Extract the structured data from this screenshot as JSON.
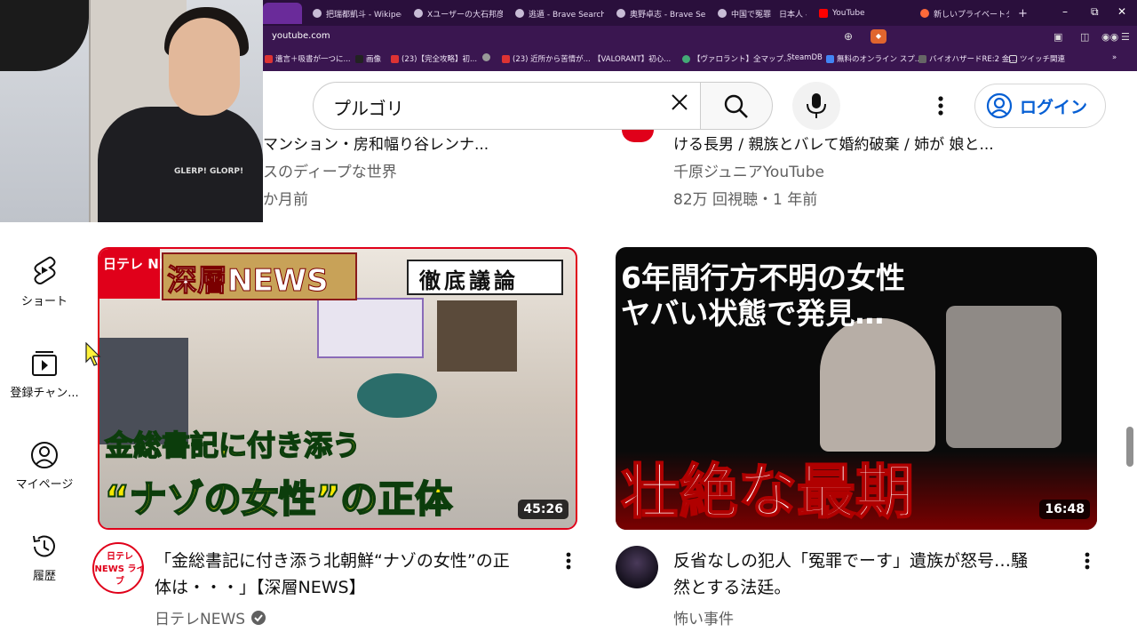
{
  "browser": {
    "tabs": [
      {
        "label": "把瑞都凱斗 - Wikipedia"
      },
      {
        "label": "Xユーザーの大石邦彦【C"
      },
      {
        "label": "逃遁 - Brave Search"
      },
      {
        "label": "奥野卓志 - Brave Search"
      },
      {
        "label": "中国で冤罪　日本人 -"
      },
      {
        "label": "YouTube"
      },
      {
        "label": "新しいプライベートタブ"
      }
    ],
    "new_tab": "+",
    "url": "youtube.com",
    "bookmarks": [
      {
        "label": "遺言＋吸書が一つに..."
      },
      {
        "label": "画像"
      },
      {
        "label": "(23)【完全攻略】初..."
      },
      {
        "label": "(23) 近所から苦情が..."
      },
      {
        "label": "【VALORANT】初心..."
      },
      {
        "label": "【ヴァロラント】全マップ..."
      },
      {
        "label": "SteamDB"
      },
      {
        "label": "無料のオンライン スプ..."
      },
      {
        "label": "バイオハザードRE:2 金..."
      },
      {
        "label": "ツイッチ関連"
      }
    ]
  },
  "webcam": {
    "shirt_text": "GLERP! GLORP!"
  },
  "header": {
    "search_value": "プルゴリ",
    "login_label": "ログイン"
  },
  "previous_row": {
    "left": {
      "title_partial": "マンション・房和幅り谷レンナ...",
      "channel_partial": "スのディープな世界",
      "meta_partial": "か月前"
    },
    "right": {
      "title_partial": "ける長男 / 親族とバレて婚約破棄 / 姉が 娘と...",
      "channel": "千原ジュニアYouTube",
      "meta": "82万 回視聴・1 年前"
    }
  },
  "sidebar": {
    "items": [
      {
        "label": "ショート"
      },
      {
        "label": "登録チャン..."
      },
      {
        "label": "マイページ"
      },
      {
        "label": "履歴"
      }
    ]
  },
  "videos": [
    {
      "title": "「金総書記に付き添う北朝鮮“ナゾの女性”の正体は・・・」【深層NEWS】",
      "title_line1": "「金総書記に付き添う北朝鮮“ナゾの女性”の正",
      "title_line2": "体は・・・」【深層NEWS】",
      "channel": "日テレNEWS",
      "verified": true,
      "duration": "45:26",
      "thumb_logo": "日テレ NEWS",
      "thumb_headline": "深層NEWS",
      "thumb_tag": "徹底議論",
      "thumb_caption1": "金総書記に付き添う",
      "thumb_caption2": "“ナゾの女性”の正体",
      "avatar_text": "日テレ NEWS ライブ"
    },
    {
      "title": "反省なしの犯人「冤罪でーす」遺族が怒号…騒然とする法廷。",
      "title_line1": "反省なしの犯人「冤罪でーす」遺族が怒号…騒",
      "title_line2": "然とする法廷。",
      "channel": "怖い事件",
      "verified": false,
      "duration": "16:48",
      "thumb_top1": "6年間行方不明の女性",
      "thumb_top2": "ヤバい状態で発見…",
      "thumb_bottom": "壮絶な最期"
    }
  ],
  "colors": {
    "accent": "#065fd4",
    "browser_bg": "#3a1650",
    "thumb_red": "#e0001a"
  }
}
